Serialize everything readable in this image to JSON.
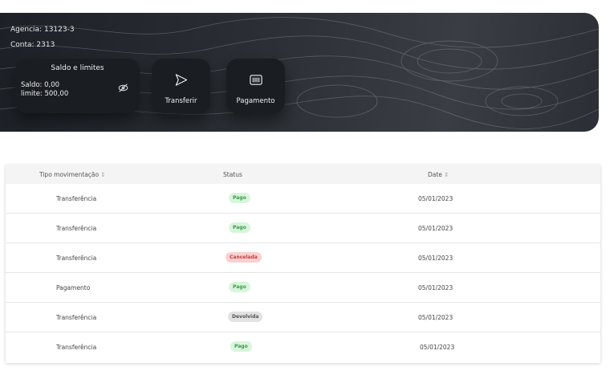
{
  "account": {
    "agencia": "Agencia: 13123-3",
    "conta": "Conta: 2313"
  },
  "balance_card": {
    "title": "Saldo e limites",
    "saldo": "Saldo: 0,00",
    "limite": "limite: 500,00",
    "icon": "eye-off-icon"
  },
  "actions": [
    {
      "label": "Transferir",
      "icon": "send-icon"
    },
    {
      "label": "Pagamento",
      "icon": "barcode-icon"
    }
  ],
  "table": {
    "headers": [
      {
        "label": "Tipo movimentação",
        "sort": "⇕"
      },
      {
        "label": "Status",
        "sort": ""
      },
      {
        "label": "Date",
        "sort": "⇕"
      }
    ],
    "rows": [
      {
        "tipo": "Transferência",
        "status": "Pago",
        "date": "05/01/2023"
      },
      {
        "tipo": "Transferência",
        "status": "Pago",
        "date": "05/01/2023"
      },
      {
        "tipo": "Transferência",
        "status": "Cancelada",
        "date": "05/01/2023"
      },
      {
        "tipo": "Pagamento",
        "status": "Pago",
        "date": "05/01/2023"
      },
      {
        "tipo": "Transferência",
        "status": "Devolvida",
        "date": "05/01/2023"
      },
      {
        "tipo": "Transferência",
        "status": "Pago",
        "date": "05/01/2023"
      }
    ]
  },
  "status_colors": {
    "Pago": {
      "bg": "#d9f5dc",
      "fg": "#3a9a46"
    },
    "Cancelada": {
      "bg": "#fbd0d0",
      "fg": "#c43c3c"
    },
    "Devolvida": {
      "bg": "#e2e2e2",
      "fg": "#555555"
    }
  }
}
